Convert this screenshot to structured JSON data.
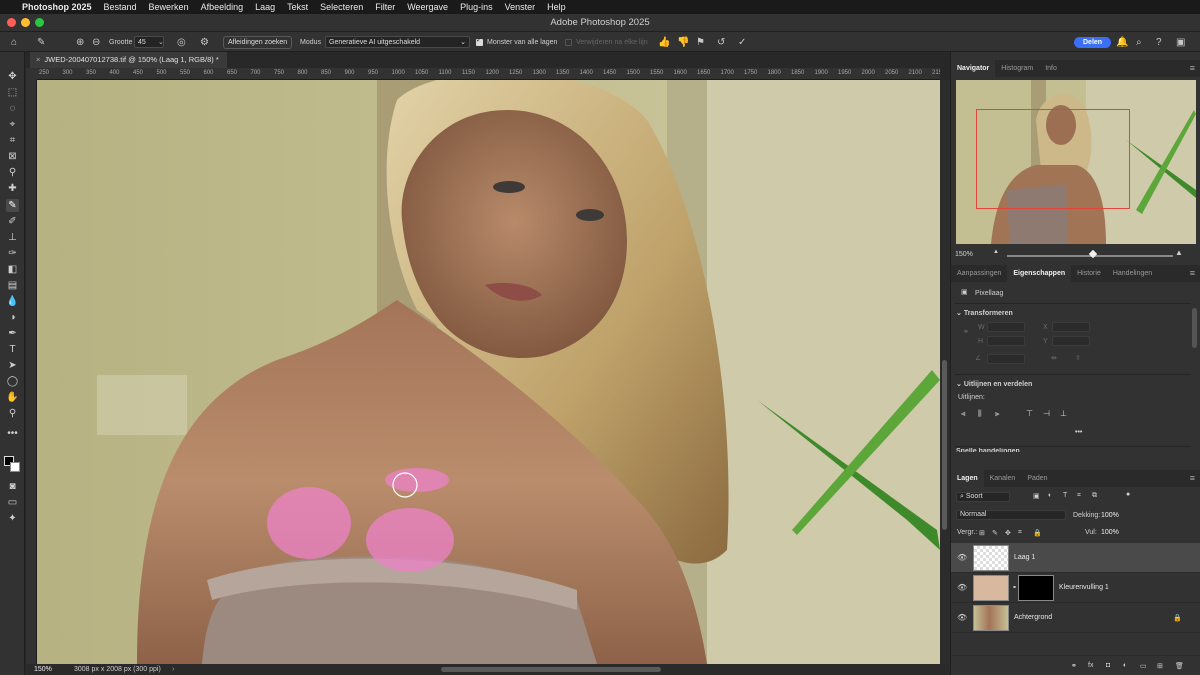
{
  "menubar": {
    "app": "Photoshop 2025",
    "items": [
      "Bestand",
      "Bewerken",
      "Afbeelding",
      "Laag",
      "Tekst",
      "Selecteren",
      "Filter",
      "Weergave",
      "Plug-ins",
      "Venster",
      "Help"
    ]
  },
  "window": {
    "title": "Adobe Photoshop 2025"
  },
  "options": {
    "size_label": "Grootte",
    "size_value": "45",
    "find_distractions": "Afleidingen zoeken",
    "mode_label": "Modus",
    "mode_value": "Generatieve AI uitgeschakeld",
    "sample_all_layers": "Monster van alle lagen",
    "sample_all_checked": true,
    "remove_all_layers": "Verwijderen na elke lijn",
    "share": "Delen"
  },
  "document": {
    "tab_title": "JWED-200407012738.tif @ 150% (Laag 1, RGB/8) *",
    "zoom": "150%",
    "doc_info": "3008 px x 2008 px (300 ppi)"
  },
  "ruler_ticks": [
    "250",
    "300",
    "350",
    "400",
    "450",
    "500",
    "550",
    "600",
    "650",
    "700",
    "750",
    "800",
    "850",
    "900",
    "950",
    "1000",
    "1050",
    "1100",
    "1150",
    "1200",
    "1250",
    "1300",
    "1350",
    "1400",
    "1450",
    "1500",
    "1550",
    "1600",
    "1650",
    "1700",
    "1750",
    "1800",
    "1850",
    "1900",
    "1950",
    "2000",
    "2050",
    "2100",
    "2150",
    "2200"
  ],
  "navigator": {
    "tabs": [
      "Navigator",
      "Histogram",
      "Info"
    ],
    "active_tab": "Navigator",
    "zoom": "150%"
  },
  "properties": {
    "tabs": [
      "Aanpassingen",
      "Eigenschappen",
      "Historie",
      "Handelingen"
    ],
    "active_tab": "Eigenschappen",
    "layer_kind": "Pixellaag",
    "transform_title": "Transformeren",
    "w": "W",
    "h": "H",
    "x": "X",
    "y": "Y",
    "align_title": "Uitlijnen en verdelen",
    "align_label": "Uitlijnen:",
    "more": "•••",
    "quick_actions": "Snelle handelingen"
  },
  "layers": {
    "tabs": [
      "Lagen",
      "Kanalen",
      "Paden"
    ],
    "active_tab": "Lagen",
    "filter": "Soort",
    "blend_mode": "Normaal",
    "opacity_label": "Dekking:",
    "opacity": "100%",
    "lock_label": "Vergr.:",
    "fill_label": "Vul:",
    "fill": "100%",
    "items": [
      {
        "name": "Laag 1",
        "selected": true
      },
      {
        "name": "Kleurenvulling 1",
        "selected": false
      },
      {
        "name": "Achtergrond",
        "selected": false
      }
    ]
  },
  "colors": {
    "accent": "#3b6ff5",
    "highlight_mask": "#ee82c8"
  }
}
